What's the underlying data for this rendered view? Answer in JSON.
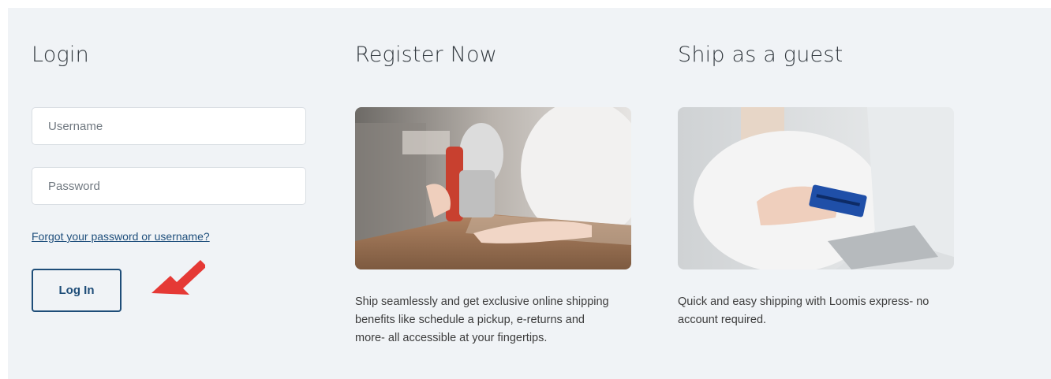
{
  "login": {
    "title": "Login",
    "username_placeholder": "Username",
    "password_placeholder": "Password",
    "forgot_link": "Forgot your password or username?",
    "button_label": "Log In"
  },
  "register": {
    "title": "Register Now",
    "description": "Ship seamlessly and get exclusive online shipping benefits like schedule a pickup, e-returns and more- all accessible at your fingertips."
  },
  "guest": {
    "title": "Ship as a guest",
    "description": "Quick and easy shipping with Loomis express- no account required."
  },
  "colors": {
    "panel_bg": "#f0f3f6",
    "accent": "#1e4d78",
    "annotation_arrow": "#e53935"
  }
}
